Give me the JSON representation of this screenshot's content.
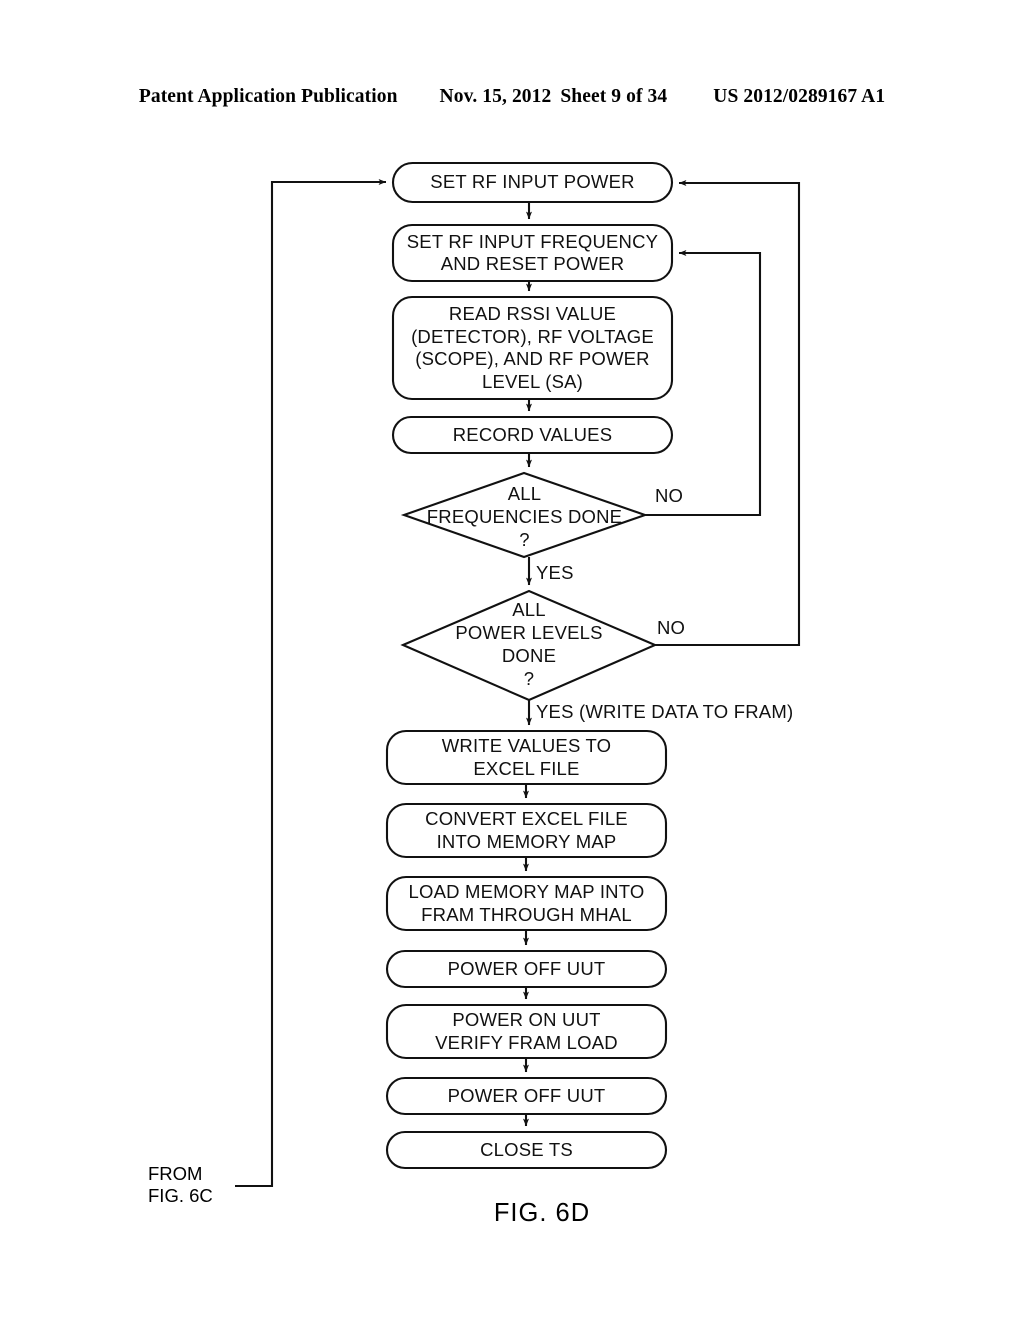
{
  "header": {
    "publication": "Patent Application Publication",
    "date": "Nov. 15, 2012",
    "sheet": "Sheet 9 of 34",
    "patent_number": "US 2012/0289167 A1"
  },
  "figure": {
    "caption": "FIG. 6D",
    "from_label": "FROM\nFIG. 6C",
    "ink_color": "#111111",
    "page_color": "#ffffff"
  },
  "flowchart": {
    "nodes": [
      {
        "id": "set-rf-input-power",
        "shape": "rounded-rect",
        "text": "SET RF INPUT POWER"
      },
      {
        "id": "set-rf-input-frequency",
        "shape": "rounded-rect",
        "text": "SET RF INPUT FREQUENCY\nAND RESET POWER"
      },
      {
        "id": "read-rssi-value",
        "shape": "rounded-rect",
        "text": "READ RSSI VALUE\n(DETECTOR), RF VOLTAGE\n(SCOPE), AND RF POWER\nLEVEL (SA)"
      },
      {
        "id": "record-values",
        "shape": "rounded-rect",
        "text": "RECORD VALUES"
      },
      {
        "id": "all-frequencies-done",
        "shape": "diamond",
        "text": "ALL\nFREQUENCIES DONE\n?"
      },
      {
        "id": "all-power-levels-done",
        "shape": "diamond",
        "text": "ALL\nPOWER LEVELS\nDONE\n?"
      },
      {
        "id": "write-values-to-excel",
        "shape": "rounded-rect",
        "text": "WRITE VALUES TO\nEXCEL FILE"
      },
      {
        "id": "convert-excel-file",
        "shape": "rounded-rect",
        "text": "CONVERT EXCEL FILE\nINTO MEMORY MAP"
      },
      {
        "id": "load-memory-map",
        "shape": "rounded-rect",
        "text": "LOAD MEMORY MAP INTO\nFRAM THROUGH MHAL"
      },
      {
        "id": "power-off-uut-1",
        "shape": "rounded-rect",
        "text": "POWER OFF UUT"
      },
      {
        "id": "power-on-uut",
        "shape": "rounded-rect",
        "text": "POWER ON UUT\nVERIFY FRAM LOAD"
      },
      {
        "id": "power-off-uut-2",
        "shape": "rounded-rect",
        "text": "POWER OFF UUT"
      },
      {
        "id": "close-ts",
        "shape": "rounded-rect",
        "text": "CLOSE TS"
      }
    ],
    "edge_labels": {
      "frequencies_no": "NO",
      "frequencies_yes": "YES",
      "power_levels_no": "NO",
      "power_levels_yes": "YES (WRITE DATA TO FRAM)"
    }
  }
}
